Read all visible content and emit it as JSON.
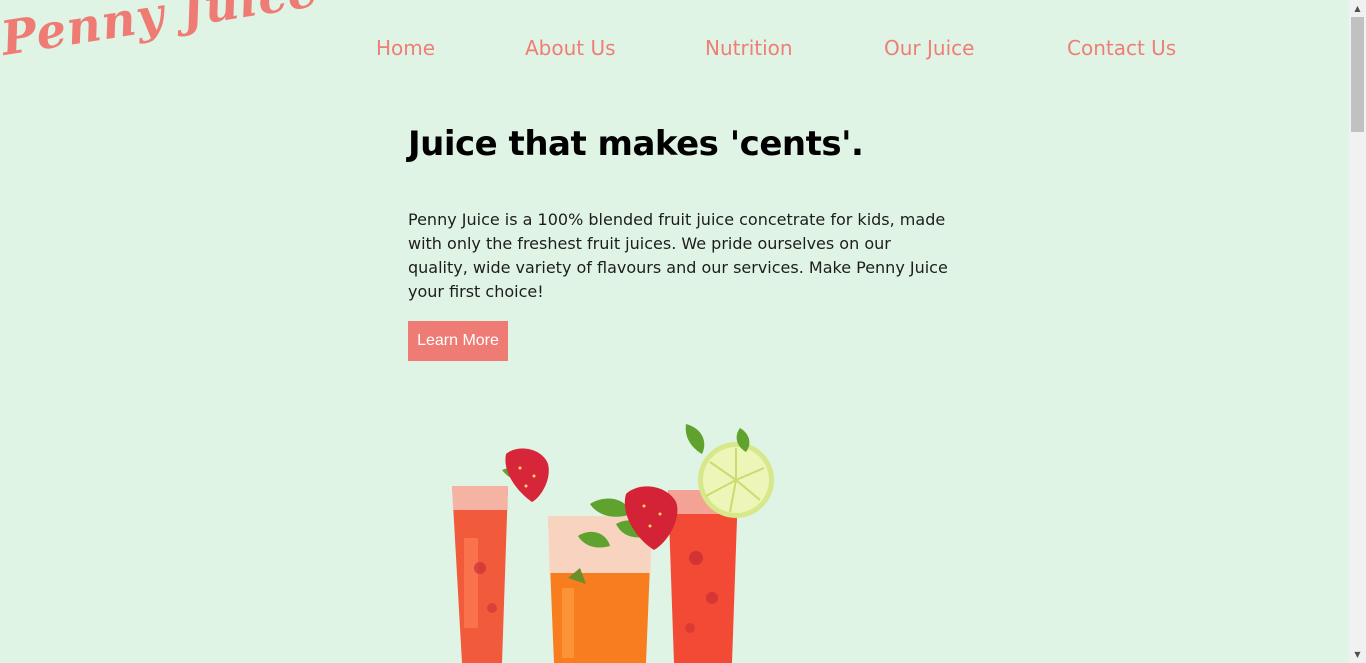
{
  "brand": {
    "logo_text": "Penny Juice",
    "accent_color": "#ee7c75",
    "background_color": "#dff4e4"
  },
  "nav": {
    "items": [
      {
        "label": "Home"
      },
      {
        "label": "About Us"
      },
      {
        "label": "Nutrition"
      },
      {
        "label": "Our Juice"
      },
      {
        "label": "Contact Us"
      }
    ]
  },
  "hero": {
    "headline": "Juice that makes 'cents'.",
    "description": "Penny Juice is a 100% blended fruit juice concetrate for kids, made with only the freshest fruit juices. We pride ourselves on our quality, wide variety of flavours and our services. Make Penny Juice your first choice!",
    "cta_label": "Learn More",
    "image_icon": "juice-glasses-image"
  },
  "scrollbar": {
    "up_icon": "scroll-up-arrow-icon",
    "down_icon": "scroll-down-arrow-icon"
  }
}
